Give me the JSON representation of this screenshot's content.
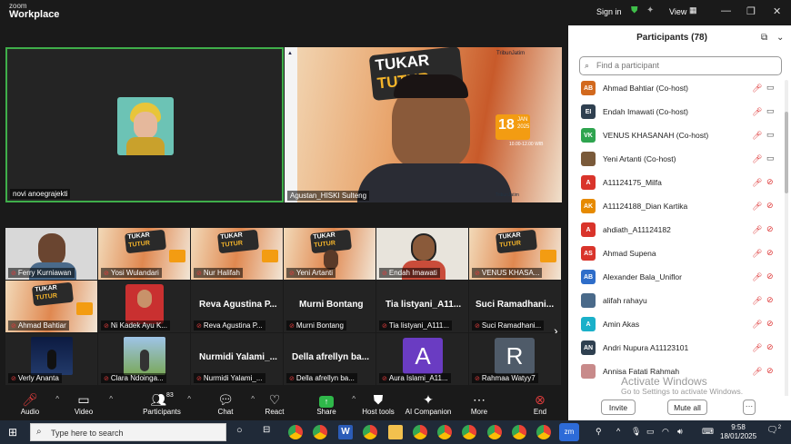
{
  "app": {
    "brand_top": "zoom",
    "brand_bottom": "Workplace"
  },
  "titlebar": {
    "signin": "Sign in",
    "view": "View",
    "minimize": "—",
    "restore": "❐",
    "close": "✕"
  },
  "tiles": {
    "speaker_left": "novi anoegrajekti",
    "speaker_right": "Agustan_HISKI Sulteng",
    "row1": [
      "Ferry Kurniawan",
      "Yosi Wulandari",
      "Nur Halifah",
      "Yeni Artanti",
      "Endah Imawati",
      "VENUS KHASA..."
    ],
    "row2_ahmad": "Ahmad Bahtiar",
    "row2_nikadek": "Ni Kadek Ayu K...",
    "row2_big": [
      "Reva Agustina P...",
      "Murni Bontang",
      "Tia listyani_A11...",
      "Suci Ramadhani..."
    ],
    "row2_small": [
      "Reva Agustina P...",
      "Murni Bontang",
      "Tia listyani_A111...",
      "Suci Ramadhani..."
    ],
    "row3_verly": "Verly Ananta",
    "row3_clara": "Clara Ndoinga...",
    "row3_big": [
      "Nurmidi Yalami_...",
      "Della afrellyn ba..."
    ],
    "row3_small": [
      "Nurmidi Yalami_...",
      "Della afrellyn ba..."
    ],
    "row3_aura_letter": "A",
    "row3_aura": "Aura Islami_A11...",
    "row3_rahmaa_letter": "R",
    "row3_rahmaa": "Rahmaa Watyy7"
  },
  "banner": {
    "line1": "TUKAR",
    "line2": "TUTUR",
    "date": "18",
    "month": "JAN",
    "year": "2025",
    "time": "10.00-12.00 WIB",
    "sponsor": "TribunJatim"
  },
  "toolbar": {
    "audio": "Audio",
    "video": "Video",
    "participants": "Participants",
    "participants_count": "83",
    "chat": "Chat",
    "react": "React",
    "share": "Share",
    "host_tools": "Host tools",
    "ai_companion": "AI Companion",
    "more": "More",
    "end": "End"
  },
  "panel": {
    "title": "Participants (78)",
    "search_placeholder": "Find a participant",
    "participants": [
      {
        "initials": "AB",
        "name": "Ahmad Bahtiar (Co-host)",
        "color": "#d2691e",
        "cam_on": true
      },
      {
        "initials": "EI",
        "name": "Endah Imawati (Co-host)",
        "color": "#2f4050",
        "cam_on": true
      },
      {
        "initials": "VK",
        "name": "VENUS KHASANAH (Co-host)",
        "color": "#2ea44f",
        "cam_on": true
      },
      {
        "initials": "",
        "name": "Yeni Artanti (Co-host)",
        "color": "#7a5a3a",
        "cam_on": true
      },
      {
        "initials": "A",
        "name": "A11124175_Milfa",
        "color": "#d9342b",
        "cam_on": false
      },
      {
        "initials": "AK",
        "name": "A11124188_Dian Kartika",
        "color": "#e68a00",
        "cam_on": false
      },
      {
        "initials": "A",
        "name": "ahdiath_A11124182",
        "color": "#d9342b",
        "cam_on": false
      },
      {
        "initials": "AS",
        "name": "Ahmad Supena",
        "color": "#d9342b",
        "cam_on": false
      },
      {
        "initials": "AB",
        "name": "Alexander Bala_Uniflor",
        "color": "#2e6dc9",
        "cam_on": false
      },
      {
        "initials": "",
        "name": "alifah rahayu",
        "color": "#4a6a8a",
        "cam_on": false
      },
      {
        "initials": "A",
        "name": "Amin Akas",
        "color": "#1ab0c9",
        "cam_on": false
      },
      {
        "initials": "AN",
        "name": "Andri Nupura A11123101",
        "color": "#2f4050",
        "cam_on": false
      },
      {
        "initials": "",
        "name": "Annisa Fatati Rahmah",
        "color": "#c88a8a",
        "cam_on": false
      }
    ],
    "invite": "Invite",
    "mute_all": "Mute all",
    "more": "···"
  },
  "watermark": {
    "line1": "Activate Windows",
    "line2": "Go to Settings to activate Windows."
  },
  "taskbar": {
    "search_placeholder": "Type here to search",
    "time": "9:58",
    "date": "18/01/2025",
    "notif": "2",
    "zm": "zm"
  }
}
